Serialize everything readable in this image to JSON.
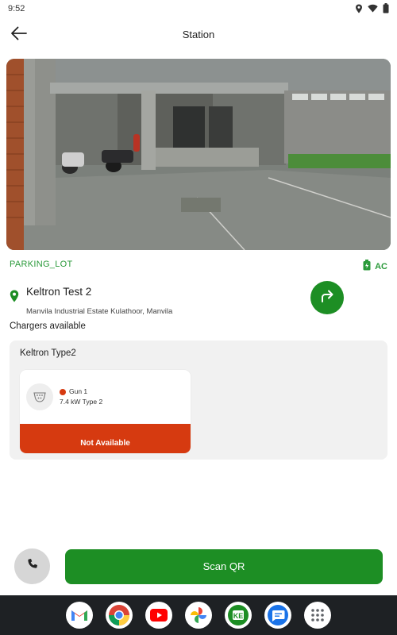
{
  "status_bar": {
    "time": "9:52",
    "icons": [
      "location-icon",
      "wifi-icon",
      "battery-icon"
    ]
  },
  "header": {
    "title": "Station",
    "back_icon": "arrow-left-icon"
  },
  "station": {
    "location_type": "PARKING_LOT",
    "current_type": "AC",
    "name": "Keltron Test 2",
    "address": "Manvila Industrial Estate Kulathoor, Manvila",
    "chargers_heading": "Chargers available"
  },
  "charger_groups": [
    {
      "title": "Keltron Type2",
      "guns": [
        {
          "name": "Gun 1",
          "spec": "7.4 kW Type 2",
          "availability": "Not Available",
          "status_color": "#d63a10"
        }
      ]
    }
  ],
  "actions": {
    "scan_label": "Scan QR",
    "call_icon": "phone-icon",
    "directions_icon": "directions-icon"
  },
  "dock": {
    "apps": [
      "gmail-icon",
      "chrome-icon",
      "youtube-icon",
      "photos-icon",
      "ev-app-icon",
      "messages-icon",
      "app-drawer-icon"
    ]
  },
  "colors": {
    "accent": "#1d8e24",
    "label_green": "#2a9a3a",
    "unavailable": "#d63a10"
  }
}
